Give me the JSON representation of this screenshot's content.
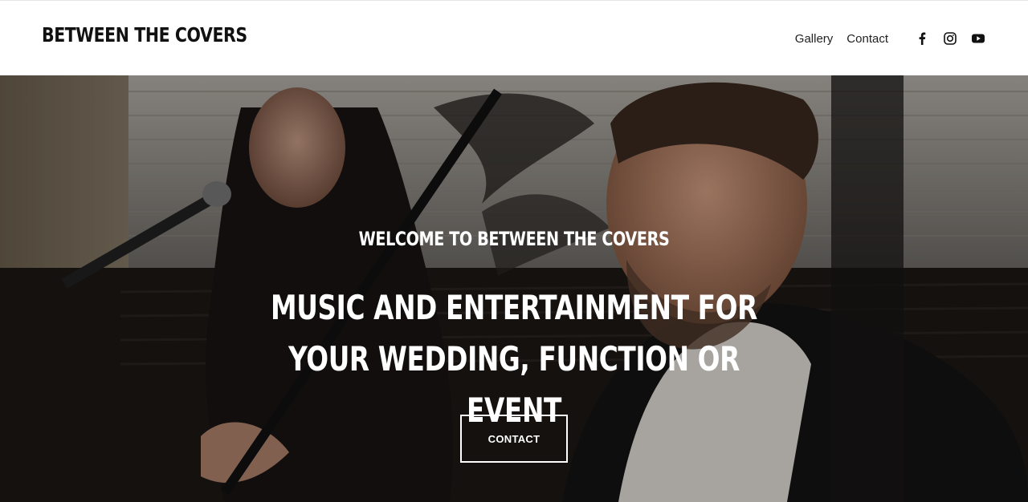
{
  "header": {
    "logo": "BETWEEN THE COVERS",
    "nav": [
      {
        "label": "Gallery"
      },
      {
        "label": "Contact"
      }
    ],
    "social": [
      {
        "icon": "facebook-icon"
      },
      {
        "icon": "instagram-icon"
      },
      {
        "icon": "youtube-icon"
      }
    ]
  },
  "hero": {
    "kicker": "WELCOME TO BETWEEN THE COVERS",
    "headline": "MUSIC AND ENTERTAINMENT FOR YOUR WEDDING, FUNCTION OR EVENT",
    "cta_label": "CONTACT",
    "image": "singers-performing-photo"
  },
  "colors": {
    "text": "#111111",
    "hero_text": "#ffffff",
    "header_bg": "#ffffff"
  }
}
